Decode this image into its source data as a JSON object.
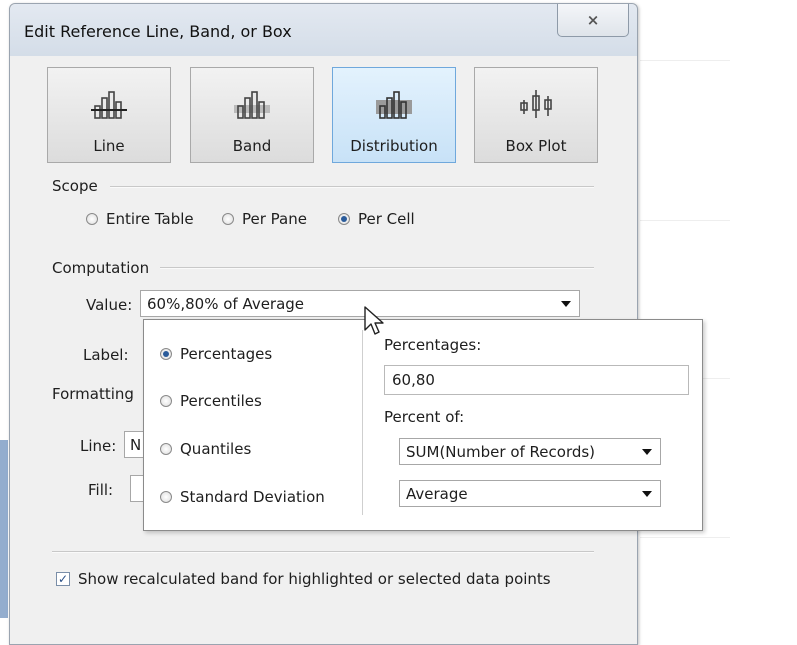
{
  "dialog": {
    "title": "Edit Reference Line, Band, or Box",
    "close_label": "⨯"
  },
  "types": [
    {
      "label": "Line",
      "icon": "line-chart-icon"
    },
    {
      "label": "Band",
      "icon": "band-chart-icon"
    },
    {
      "label": "Distribution",
      "icon": "distribution-chart-icon",
      "selected": true
    },
    {
      "label": "Box Plot",
      "icon": "box-plot-icon"
    }
  ],
  "scope": {
    "label": "Scope",
    "options": [
      "Entire Table",
      "Per Pane",
      "Per Cell"
    ],
    "selected": "Per Cell"
  },
  "computation": {
    "label": "Computation",
    "value_label": "Value:",
    "value": "60%,80% of Average",
    "label_label": "Label:"
  },
  "formatting": {
    "label": "Formatting",
    "line_label": "Line:",
    "line_value_partial": "N",
    "fill_label": "Fill:"
  },
  "popup": {
    "options": [
      "Percentages",
      "Percentiles",
      "Quantiles",
      "Standard Deviation"
    ],
    "selected": "Percentages",
    "percentages_label": "Percentages:",
    "percentages_value": "60,80",
    "percent_of_label": "Percent of:",
    "field_value": "SUM(Number of Records)",
    "aggregation_value": "Average"
  },
  "footer": {
    "show_recalculated_label": "Show recalculated band for highlighted or selected data points",
    "show_recalculated_checked": true,
    "check_mark": "✓"
  },
  "colors": {
    "selected_button": "#c8e2f7",
    "radio_dot": "#2a5b9a"
  }
}
